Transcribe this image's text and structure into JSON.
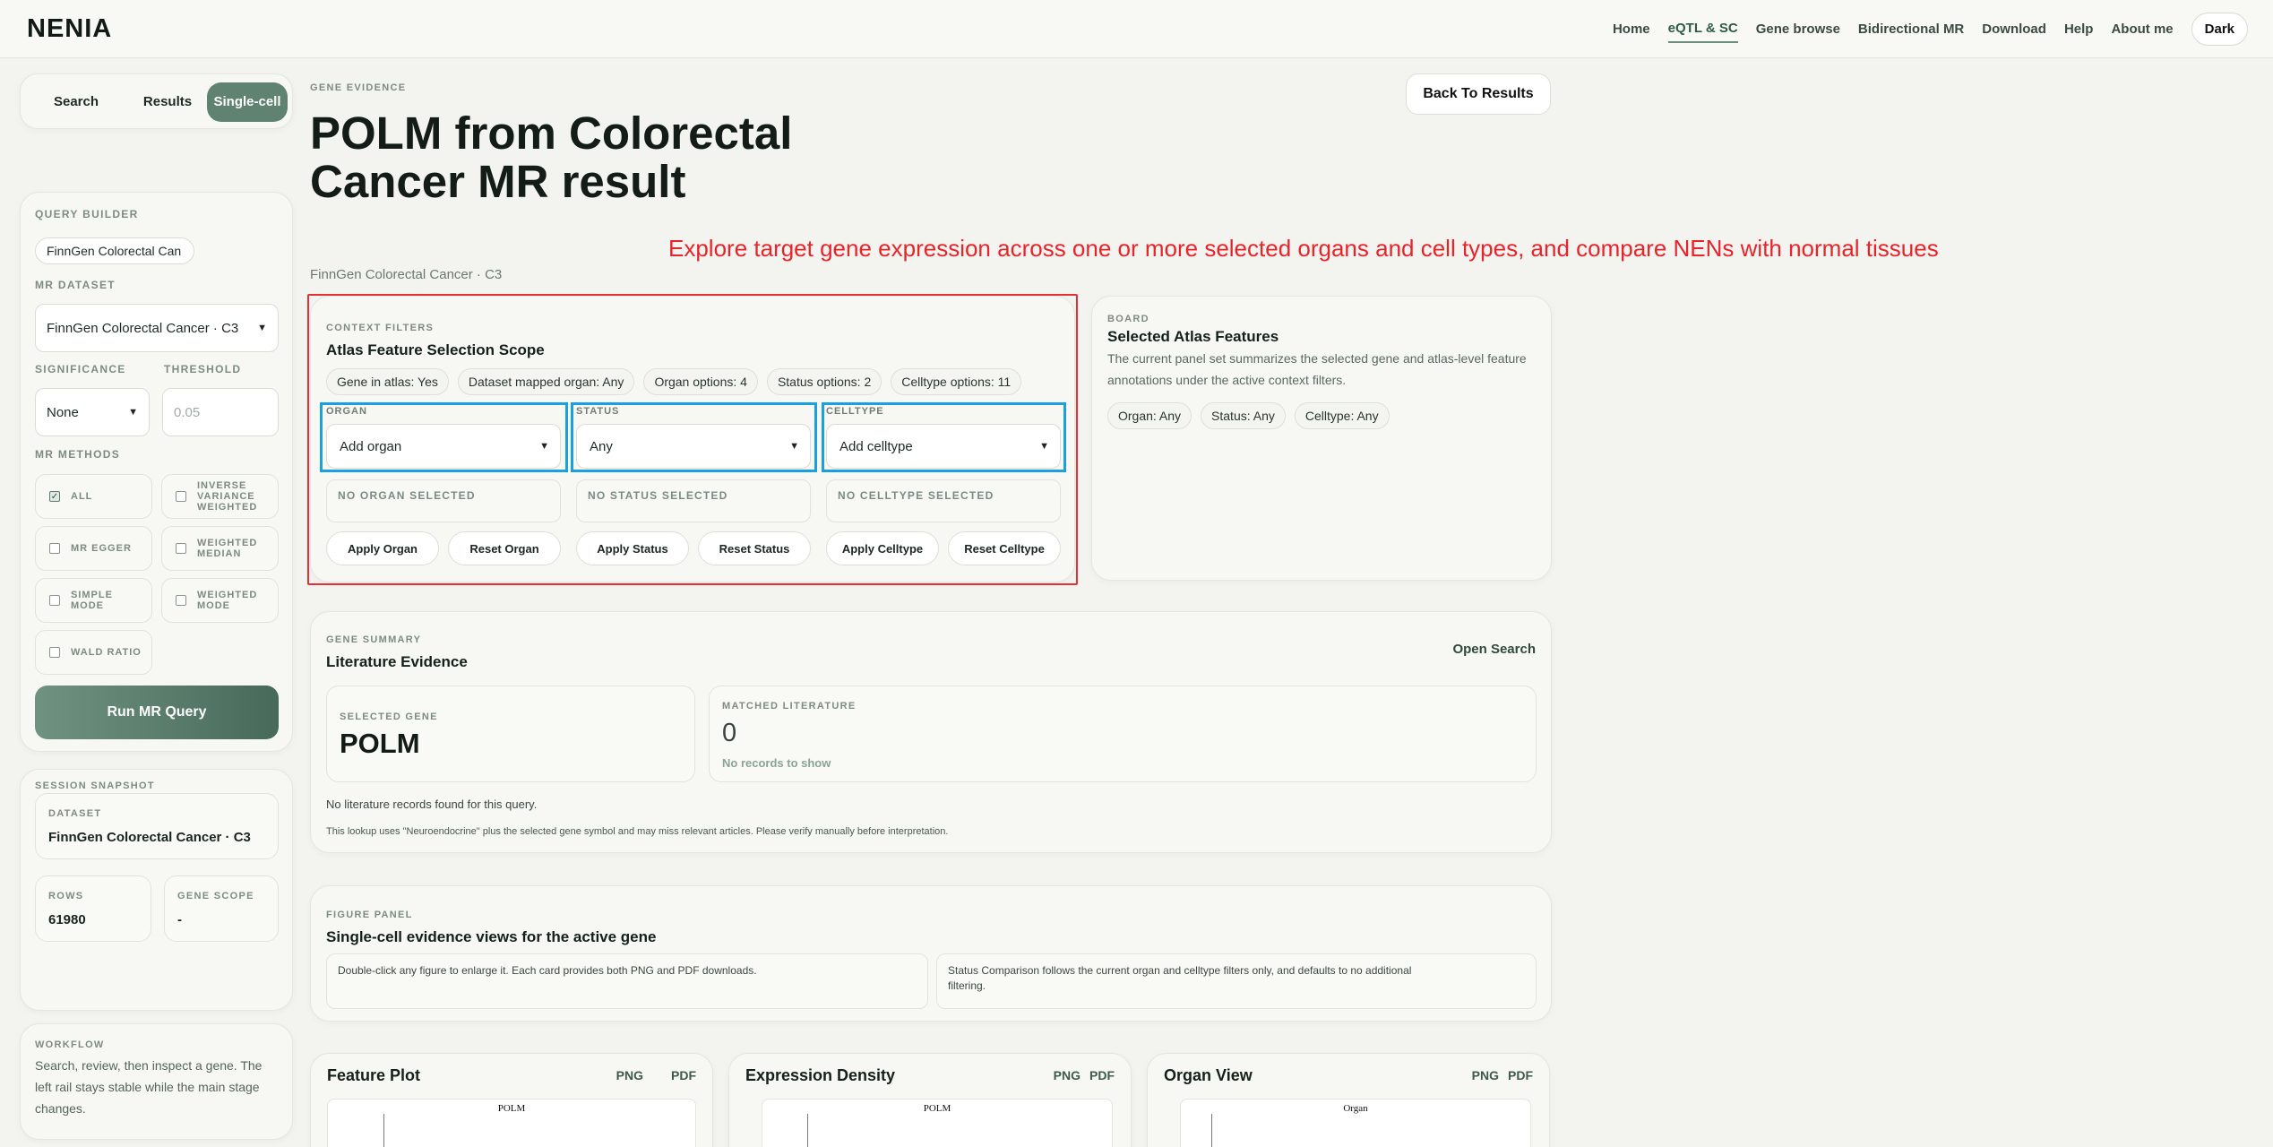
{
  "brand": "NENIA",
  "nav": {
    "items": [
      "Home",
      "eQTL & SC",
      "Gene browse",
      "Bidirectional MR",
      "Download",
      "Help",
      "About me"
    ],
    "active": "eQTL & SC",
    "theme_toggle": "Dark"
  },
  "left_tabs": [
    "Search",
    "Results",
    "Single-cell"
  ],
  "query_builder": {
    "heading": "QUERY BUILDER",
    "search_value": "FinnGen Colorectal Can",
    "mr_dataset_label": "MR DATASET",
    "mr_dataset_value": "FinnGen Colorectal Cancer · C3",
    "significance_label": "SIGNIFICANCE",
    "significance_value": "None",
    "threshold_label": "THRESHOLD",
    "threshold_placeholder": "0.05",
    "methods_label": "MR METHODS",
    "methods": [
      {
        "label": "ALL",
        "checked": true
      },
      {
        "label": "INVERSE VARIANCE WEIGHTED",
        "checked": false
      },
      {
        "label": "MR EGGER",
        "checked": false
      },
      {
        "label": "WEIGHTED MEDIAN",
        "checked": false
      },
      {
        "label": "SIMPLE MODE",
        "checked": false
      },
      {
        "label": "WEIGHTED MODE",
        "checked": false
      },
      {
        "label": "WALD RATIO",
        "checked": false
      }
    ],
    "run_button": "Run MR Query"
  },
  "session": {
    "heading": "SESSION SNAPSHOT",
    "dataset_label": "DATASET",
    "dataset_value": "FinnGen Colorectal Cancer · C3",
    "rows_label": "ROWS",
    "rows_value": "61980",
    "gene_scope_label": "GENE SCOPE",
    "gene_scope_value": "-"
  },
  "workflow": {
    "heading": "WORKFLOW",
    "text": "Search, review, then inspect a gene. The left rail stays stable while the main stage changes."
  },
  "hero": {
    "eyebrow": "GENE EVIDENCE",
    "title": "POLM from Colorectal Cancer MR result",
    "subtitle": "FinnGen Colorectal Cancer · C3",
    "back_button": "Back To Results"
  },
  "annotation": "Explore target gene expression across one or more selected organs and cell types, and compare NENs with normal tissues",
  "context": {
    "eyebrow": "CONTEXT FILTERS",
    "title": "Atlas Feature Selection Scope",
    "pills": [
      "Gene in atlas: Yes",
      "Dataset mapped organ: Any",
      "Organ options: 4",
      "Status options: 2",
      "Celltype options: 11"
    ],
    "organ": {
      "label": "ORGAN",
      "value": "Add organ",
      "none": "NO ORGAN SELECTED",
      "apply": "Apply Organ",
      "reset": "Reset Organ"
    },
    "status": {
      "label": "STATUS",
      "value": "Any",
      "none": "NO STATUS SELECTED",
      "apply": "Apply Status",
      "reset": "Reset Status"
    },
    "celltype": {
      "label": "CELLTYPE",
      "value": "Add celltype",
      "none": "NO CELLTYPE SELECTED",
      "apply": "Apply Celltype",
      "reset": "Reset Celltype"
    }
  },
  "board": {
    "eyebrow": "BOARD",
    "title": "Selected Atlas Features",
    "desc": "The current panel set summarizes the selected gene and atlas-level feature annotations under the active context filters.",
    "pills": [
      "Organ: Any",
      "Status: Any",
      "Celltype: Any"
    ]
  },
  "literature": {
    "eyebrow": "GENE SUMMARY",
    "title": "Literature Evidence",
    "open_search": "Open Search",
    "selected_gene_label": "SELECTED GENE",
    "selected_gene": "POLM",
    "matched_label": "MATCHED LITERATURE",
    "matched_value": "0",
    "matched_note": "No records to show",
    "empty_msg": "No literature records found for this query.",
    "disclaimer": "This lookup uses \"Neuroendocrine\" plus the selected gene symbol and may miss relevant articles. Please verify manually before interpretation."
  },
  "figure_panel": {
    "eyebrow": "FIGURE PANEL",
    "title": "Single-cell evidence views for the active gene",
    "note_left": "Double-click any figure to enlarge it. Each card provides both PNG and PDF downloads.",
    "note_right": "Status Comparison follows the current organ and celltype filters only, and defaults to no additional filtering."
  },
  "plots": [
    {
      "title": "Feature Plot",
      "png": "PNG",
      "pdf": "PDF",
      "inner_title": "POLM"
    },
    {
      "title": "Expression Density",
      "png": "PNG",
      "pdf": "PDF",
      "inner_title": "POLM"
    },
    {
      "title": "Organ View",
      "png": "PNG",
      "pdf": "PDF",
      "inner_title": "Organ"
    }
  ]
}
